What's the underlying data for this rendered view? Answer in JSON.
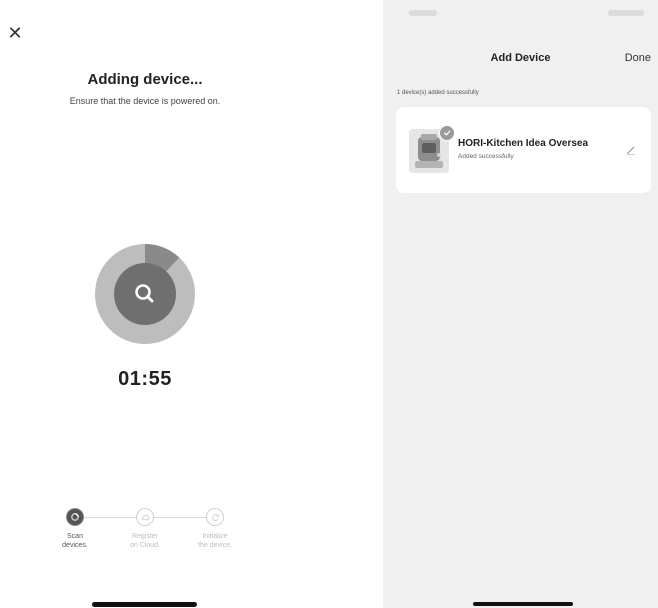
{
  "adding_screen": {
    "close_icon": "close-icon",
    "title": "Adding device...",
    "subtitle": "Ensure that the device is powered on.",
    "search_icon": "search-icon",
    "progress_fraction": 0.12,
    "timer": "01:55",
    "steps": [
      {
        "line1": "Scan",
        "line2": "devices.",
        "state": "active"
      },
      {
        "line1": "Register",
        "line2": "on Cloud.",
        "state": "pending"
      },
      {
        "line1": "Initialize",
        "line2": "the device.",
        "state": "pending"
      }
    ]
  },
  "add_device_screen": {
    "title": "Add Device",
    "done_label": "Done",
    "added_count_text": "1 device(s) added successfully",
    "device": {
      "name": "HORI-Kitchen Idea Oversea",
      "status": "Added successfully",
      "check_icon": "check-icon",
      "edit_icon": "pencil-icon"
    }
  },
  "colors": {
    "ring_outer": "#bdbdbd",
    "ring_progress": "#8a8a8a",
    "ring_inner": "#6f6f6f",
    "right_background": "#f0f0f0"
  }
}
